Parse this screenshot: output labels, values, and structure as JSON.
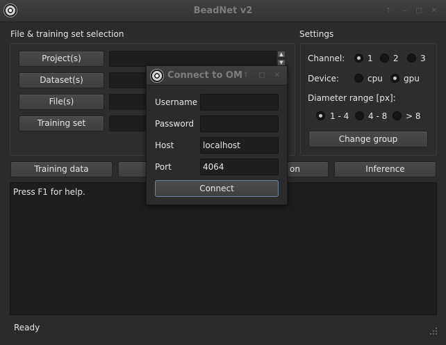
{
  "window": {
    "title": "BeadNet v2",
    "controls": [
      "↑",
      "–",
      "□",
      "✕"
    ]
  },
  "file_section": {
    "title": "File & training set selection",
    "buttons": [
      "Project(s)",
      "Dataset(s)",
      "File(s)",
      "Training set"
    ]
  },
  "settings": {
    "title": "Settings",
    "channel_label": "Channel:",
    "channels": [
      "1",
      "2",
      "3"
    ],
    "channel_selected": "1",
    "device_label": "Device:",
    "devices": [
      "cpu",
      "gpu"
    ],
    "device_selected": "gpu",
    "diameter_label": "Diameter range [px]:",
    "diameters": [
      "1 - 4",
      "4 - 8",
      "> 8"
    ],
    "diameter_selected": "1 - 4",
    "change_group": "Change group"
  },
  "actions": {
    "training_data": "Training data",
    "hidden_suffix": "on",
    "inference": "Inference"
  },
  "console": {
    "text": "Press F1 for help."
  },
  "status": {
    "text": "Ready"
  },
  "dialog": {
    "title": "Connect to OM",
    "controls": [
      "↑",
      "□",
      "✕"
    ],
    "username_label": "Username",
    "username_value": "",
    "password_label": "Password",
    "password_value": "",
    "host_label": "Host",
    "host_value": "localhost",
    "port_label": "Port",
    "port_value": "4064",
    "connect_label": "Connect"
  },
  "colors": {
    "background": "#2b2b2b",
    "field": "#1f1f1f",
    "accent_border": "#6c86a6"
  }
}
